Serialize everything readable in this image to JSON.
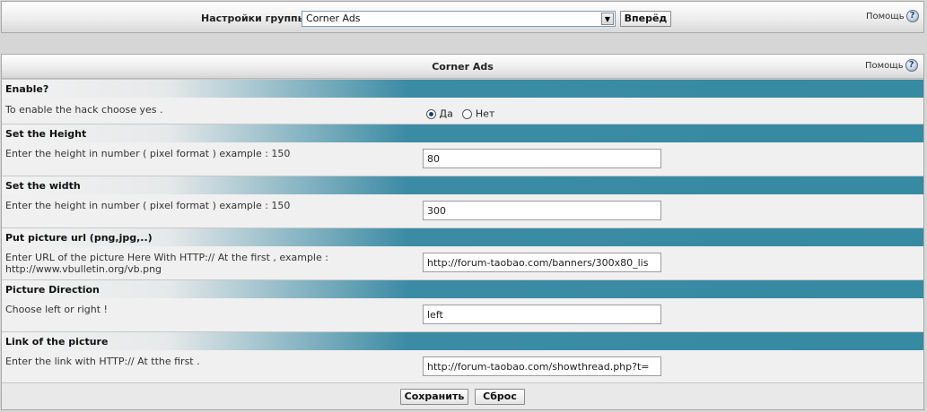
{
  "top": {
    "group_label": "Настройки группы",
    "group_value": "Corner Ads",
    "go_button": "Вперёд",
    "help_label": "Помощь"
  },
  "main": {
    "title": "Corner Ads",
    "help_label": "Помощь",
    "sections": [
      {
        "heading": "Enable?",
        "description": "To enable the hack choose yes .",
        "yes_label": "Да",
        "no_label": "Нет",
        "selected": "Да"
      },
      {
        "heading": "Set the Height",
        "description": "Enter the height in number ( pixel format ) example : 150",
        "value": "80"
      },
      {
        "heading": "Set the width",
        "description": "Enter the height in number ( pixel format ) example : 150",
        "value": "300"
      },
      {
        "heading": "Put picture url (png,jpg,..)",
        "description": "Enter URL of the picture Here With HTTP:// At the first , example : http://www.vbulletin.org/vb.png",
        "value": "http://forum-taobao.com/banners/300x80_lis"
      },
      {
        "heading": "Picture Direction",
        "description": "Choose left or right !",
        "value": "left"
      },
      {
        "heading": "Link of the picture",
        "description": "Enter the link with HTTP:// At tthe first .",
        "value": "http://forum-taobao.com/showthread.php?t="
      }
    ],
    "save_button": "Сохранить",
    "reset_button": "Сброс"
  },
  "colors": {
    "section_bar": "#368aa2",
    "panel_bg": "#f0f0f0"
  },
  "icons": [
    "help-icon",
    "dropdown-arrow-icon",
    "radio-icon"
  ]
}
